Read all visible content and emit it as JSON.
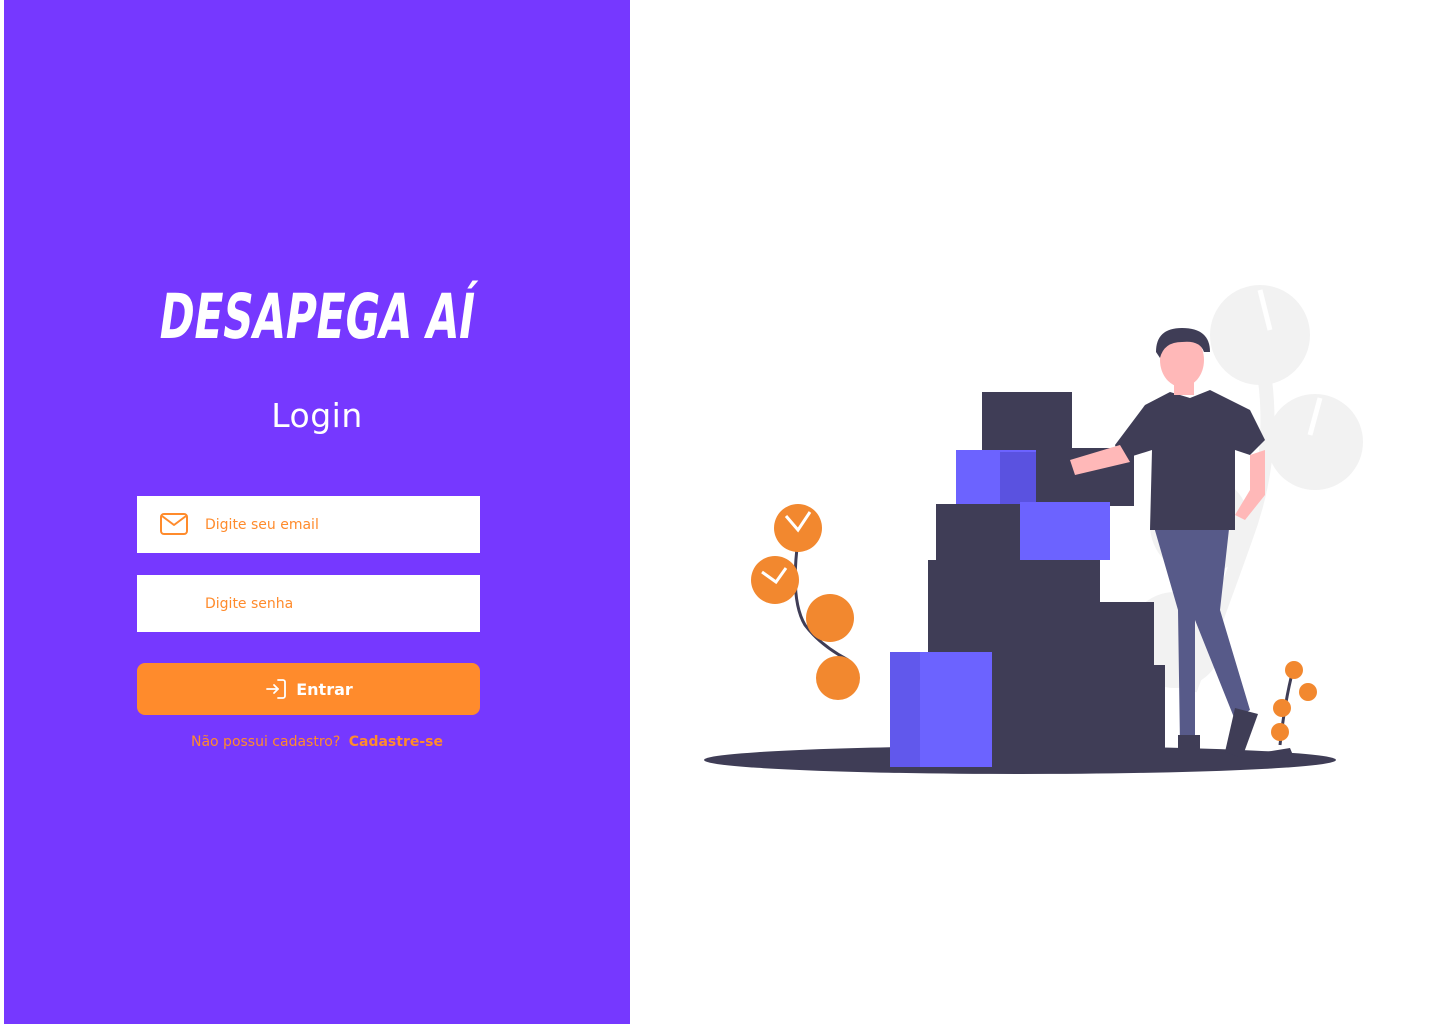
{
  "brand": {
    "logo_text": "DESAPEGA AÍ",
    "primary_color": "#7638ff",
    "accent_color": "#ff8b2c"
  },
  "login": {
    "title": "Login",
    "email": {
      "placeholder": "Digite seu email",
      "value": "",
      "icon": "mail-icon"
    },
    "password": {
      "placeholder": "Digite senha",
      "value": ""
    },
    "submit": {
      "label": "Entrar",
      "icon": "login-icon"
    },
    "signup": {
      "prompt": "Não possui cadastro?",
      "link_label": "Cadastre-se"
    }
  },
  "illustration": {
    "subject": "person-with-boxes",
    "colors": {
      "dark": "#3f3d56",
      "blue": "#6c63ff",
      "orange": "#f2882f",
      "skin": "#ffb8b8",
      "pants": "#575a89",
      "plant_bg": "#f2f2f2"
    }
  }
}
